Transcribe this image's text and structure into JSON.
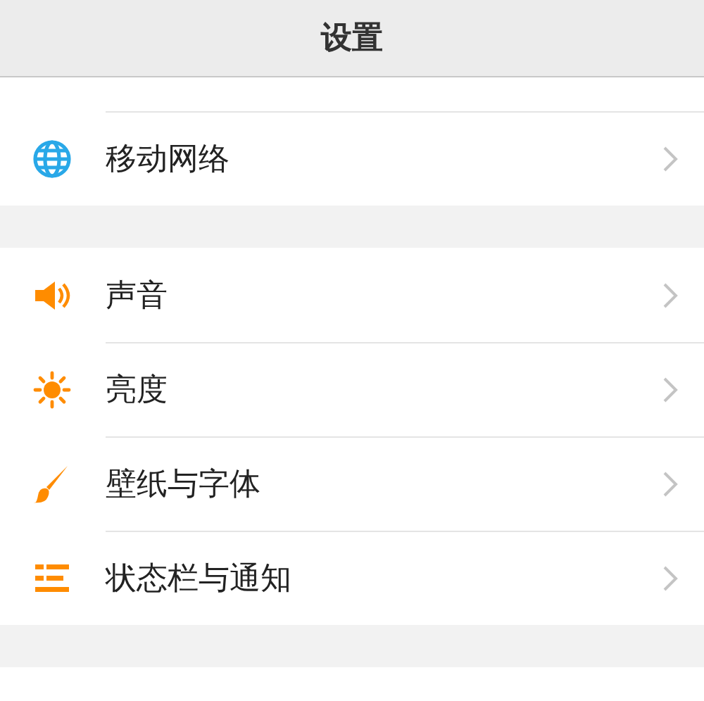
{
  "header": {
    "title": "设置"
  },
  "groups": [
    {
      "items": [
        {
          "kind": "globe",
          "label": "移动网络"
        }
      ]
    },
    {
      "items": [
        {
          "kind": "speaker",
          "label": "声音"
        },
        {
          "kind": "sun",
          "label": "亮度"
        },
        {
          "kind": "brush",
          "label": "壁纸与字体"
        },
        {
          "kind": "lines",
          "label": "状态栏与通知"
        }
      ]
    }
  ]
}
